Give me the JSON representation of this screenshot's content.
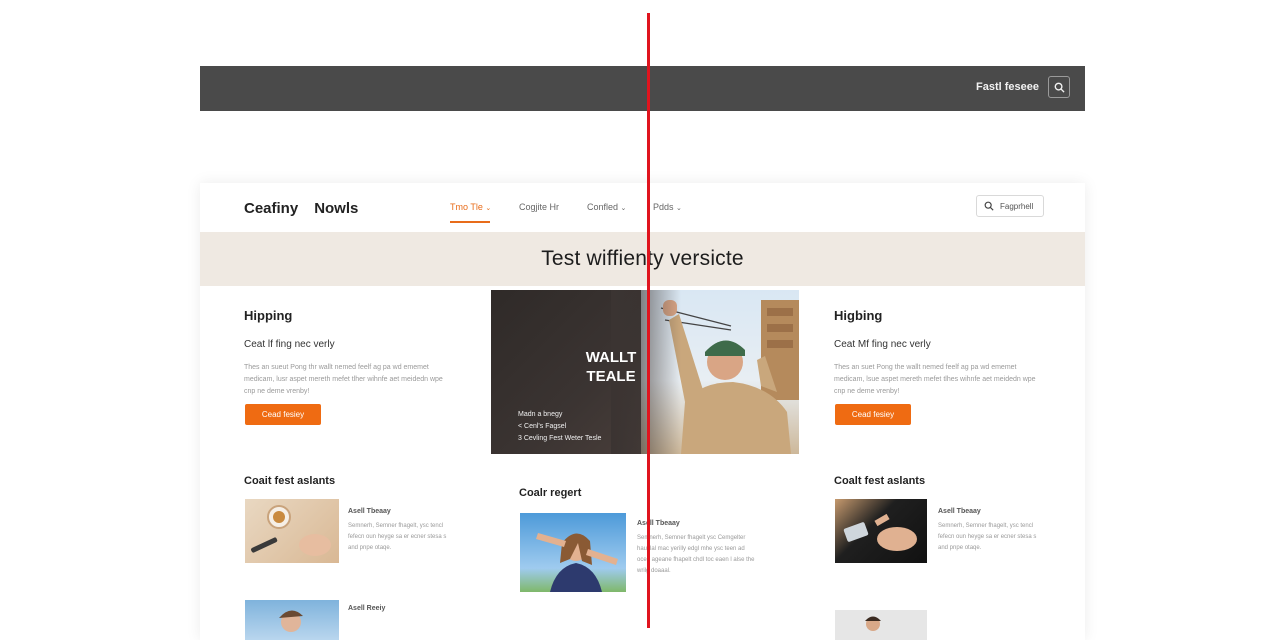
{
  "topbar": {
    "label": "Fastl feseee",
    "search_icon": "search-icon"
  },
  "site": {
    "logo": [
      "Ceafiny",
      "Nowls"
    ],
    "nav": [
      {
        "label": "Tmo Tle",
        "active": true,
        "dropdown": true
      },
      {
        "label": "Cogjite Hr",
        "active": false,
        "dropdown": false
      },
      {
        "label": "Confled",
        "active": false,
        "dropdown": true
      },
      {
        "label": "Pdds",
        "active": false,
        "dropdown": true
      }
    ],
    "search": {
      "placeholder": "Fagprhell"
    },
    "hero_title": "Test wiffienty versicte",
    "accent": "#ef6b12",
    "hero_bg": "#efe9e2",
    "left": {
      "title": "Hipping",
      "subtitle": "Ceat lf fing nec verly",
      "text": "Thes an sueut Pong thr wallt nemed feelf ag pa wd ememet medicam, lusr aspet mereth mefet tlher wihnfe aet meidedn wpe cnp ne deme vrenby!",
      "button": "Cead fesiey",
      "section": "Coait fest aslants"
    },
    "center": {
      "feature_title": "WALLT TEALE",
      "feature_list": [
        "Madn a bnegy",
        "< Cenl's Fagsel",
        "3 Cevling Fest Weter Tesle"
      ],
      "section": "Coalr regert"
    },
    "right": {
      "title": "Higbing",
      "subtitle": "Ceat Mf fing nec verly",
      "text": "Thes an suet Pong the wallt nemed feelf ag pa wd ememet medicam, lsue aspet mereth mefet tlhes wihnfe aet meidedn wpe cnp ne deme vrenby!",
      "button": "Cead fesiey",
      "section": "Coalt fest aslants"
    },
    "cards": [
      {
        "title": "Asell Tbeaay",
        "text": "Semnerh, Semner fhagelt, ysc tencl fefecn oun heyge sa er ecner stesa s and pnpe otaqe."
      },
      {
        "title": "Asell Tbeaay",
        "text": "Semnerh, Semner fhagelt ysc Cemgelter hauclal mac yerilly edgl mhe ysc teen ad ocee ageane fhapelt chdl toc eaen l alse the wrilg doaaal."
      },
      {
        "title": "Asell Tbeaay",
        "text": "Semnerh, Semner fhagelt, ysc tencl fefecn oun heyge sa er ecner stesa s and pnpe otaqe."
      },
      {
        "title": "Asell Reeiy",
        "text": ""
      }
    ],
    "red_line_color": "#e0141e"
  }
}
